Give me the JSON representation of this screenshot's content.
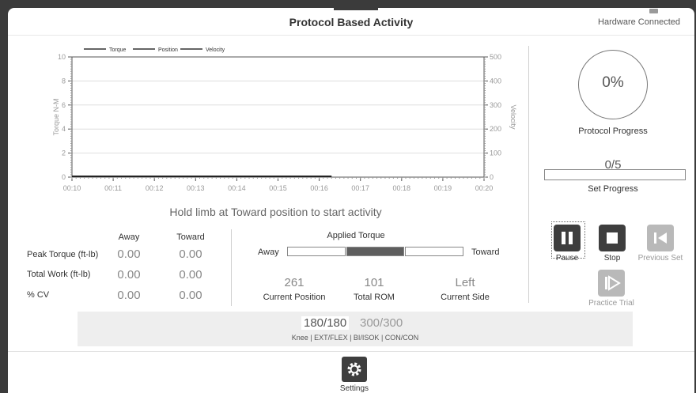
{
  "header": {
    "title": "Protocol Based Activity",
    "status": "Hardware Connected"
  },
  "chart": {
    "legend": [
      "Torque",
      "Position",
      "Velocity"
    ],
    "ylabel_left": "Torque N-M",
    "ylabel_right": "Velocity"
  },
  "chart_data": {
    "type": "line",
    "xlabel": "",
    "ylabel": "Torque N-M",
    "ylabel_right": "Velocity",
    "x_ticks": [
      "00:10",
      "00:11",
      "00:12",
      "00:13",
      "00:14",
      "00:15",
      "00:16",
      "00:17",
      "00:18",
      "00:19",
      "00:20"
    ],
    "y_left_ticks": [
      0,
      2,
      4,
      6,
      8,
      10
    ],
    "y_right_ticks": [
      0,
      100,
      200,
      300,
      400,
      500
    ],
    "ylim": [
      0,
      10
    ],
    "ylim_right": [
      0,
      500
    ],
    "grid": true,
    "legend_position": "top-left",
    "series": [
      {
        "name": "Torque",
        "x": [
          "00:10",
          "00:16.3"
        ],
        "values": [
          0,
          0
        ]
      },
      {
        "name": "Position",
        "x": [],
        "values": []
      },
      {
        "name": "Velocity",
        "x": [],
        "values": []
      }
    ]
  },
  "instruction": "Hold limb at Toward position to start activity",
  "stats": {
    "col_away": "Away",
    "col_toward": "Toward",
    "rows": [
      {
        "label": "Peak Torque (ft-lb)",
        "away": "0.00",
        "toward": "0.00"
      },
      {
        "label": "Total Work (ft-lb)",
        "away": "0.00",
        "toward": "0.00"
      },
      {
        "label": "% CV",
        "away": "0.00",
        "toward": "0.00"
      }
    ]
  },
  "torque": {
    "title": "Applied Torque",
    "away": "Away",
    "toward": "Toward",
    "center_fill": 1.0
  },
  "metrics": [
    {
      "value": "261",
      "label": "Current Position"
    },
    {
      "value": "101",
      "label": "Total ROM"
    },
    {
      "value": "Left",
      "label": "Current Side"
    }
  ],
  "progress": {
    "percent": "0%",
    "label": "Protocol Progress",
    "sets": "0/5",
    "sets_fraction": 0,
    "sets_label": "Set Progress"
  },
  "controls": {
    "pause": "Pause",
    "stop": "Stop",
    "previous": "Previous Set",
    "practice": "Practice Trial"
  },
  "mode": {
    "primary": "180/180",
    "secondary": "300/300",
    "description": "Knee | EXT/FLEX | BI/ISOK | CON/CON"
  },
  "footer": {
    "settings": "Settings"
  },
  "colors": {
    "accent_dark": "#3e3e3e",
    "disabled": "#b9b9b9"
  }
}
